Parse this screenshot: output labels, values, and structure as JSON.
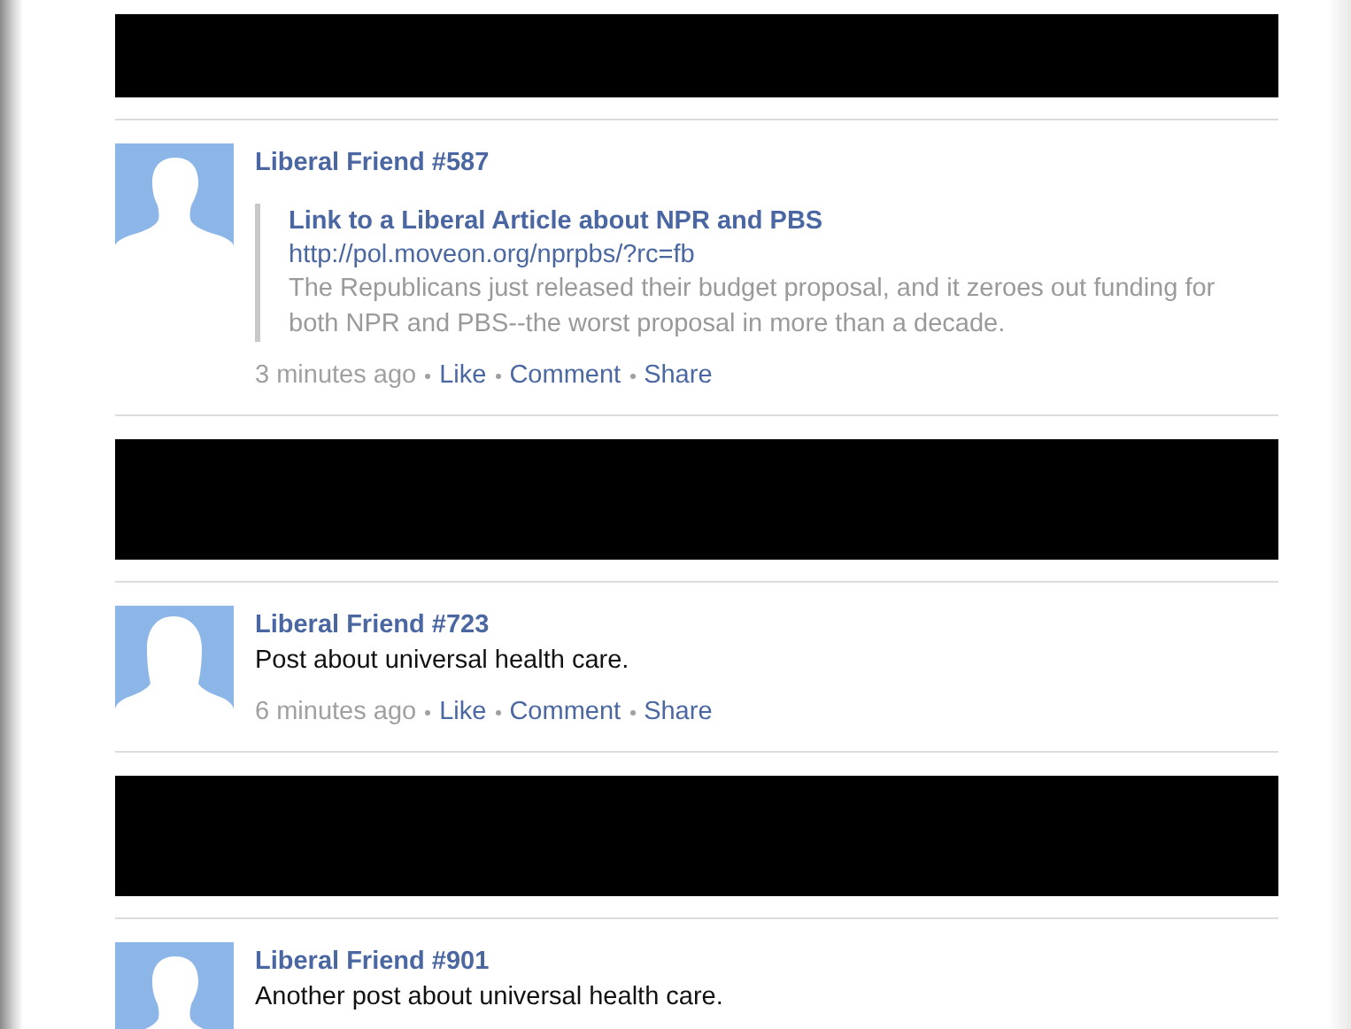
{
  "feed": [
    {
      "kind": "hidden"
    },
    {
      "kind": "post",
      "avatar": {
        "kind": "male"
      },
      "author": "Liberal Friend #587",
      "link": {
        "title": "Link to a Liberal Article about NPR and PBS",
        "url": "http://pol.moveon.org/nprpbs/?rc=fb",
        "description": "The Republicans just released their budget proposal, and it zeroes out funding for both NPR and PBS--the worst proposal in more than a decade."
      },
      "time": "3 minutes ago",
      "actions": [
        "Like",
        "Comment",
        "Share"
      ]
    },
    {
      "kind": "hidden"
    },
    {
      "kind": "post",
      "avatar": {
        "kind": "female"
      },
      "author": "Liberal Friend #723",
      "text": "Post about universal health care.",
      "time": "6 minutes ago",
      "actions": [
        "Like",
        "Comment",
        "Share"
      ]
    },
    {
      "kind": "hidden"
    },
    {
      "kind": "post",
      "avatar": {
        "kind": "male"
      },
      "author": "Liberal Friend #901",
      "text": "Another post about universal health care."
    }
  ]
}
